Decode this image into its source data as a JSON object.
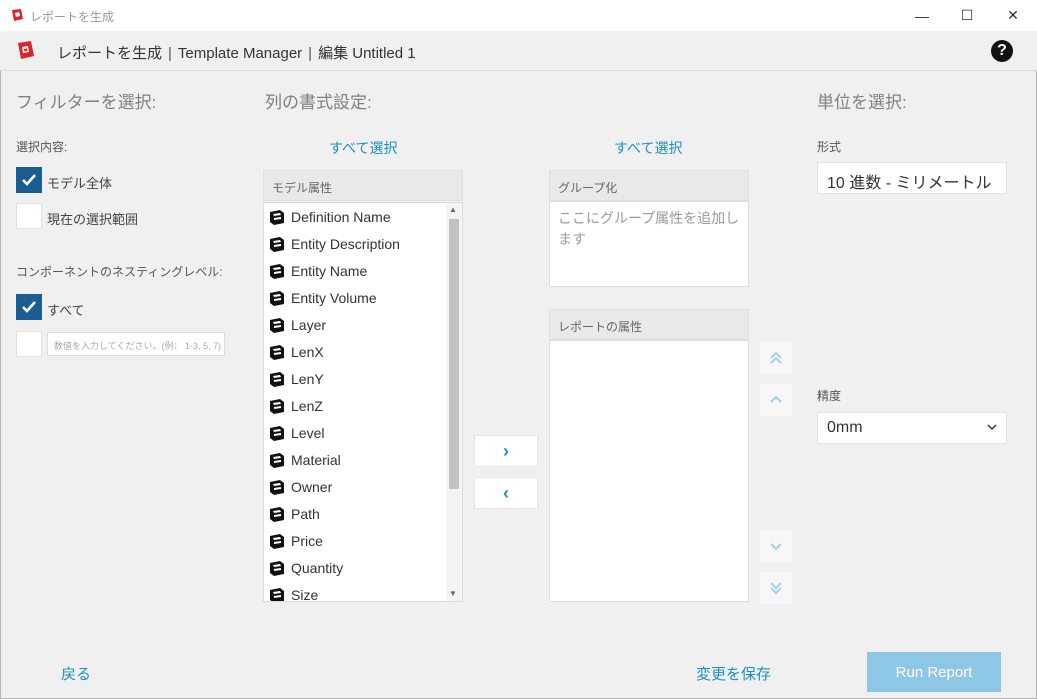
{
  "window": {
    "title": "レポートを生成",
    "minimize": "—",
    "maximize": "☐",
    "close": "✕"
  },
  "header": {
    "crumb1": "レポートを生成",
    "crumb2": "Template Manager",
    "crumb3": "編集 Untitled 1",
    "separator": "|",
    "help": "?"
  },
  "filters": {
    "title": "フィルターを選択:",
    "selection_label": "選択内容:",
    "whole_model": "モデル全体",
    "current_selection": "現在の選択範囲",
    "nesting_label": "コンポーネントのネスティングレベル:",
    "all": "すべて",
    "nest_placeholder": "数値を入力してください。(例： 1-3, 5, 7)"
  },
  "columns": {
    "title": "列の書式設定:",
    "select_all_left": "すべて選択",
    "select_all_right": "すべて選択",
    "model_attrs_header": "モデル属性",
    "group_header": "グループ化",
    "group_placeholder": "ここにグループ属性を追加します",
    "report_attrs_header": "レポートの属性",
    "attributes": [
      "Definition Name",
      "Entity Description",
      "Entity Name",
      "Entity Volume",
      "Layer",
      "LenX",
      "LenY",
      "LenZ",
      "Level",
      "Material",
      "Owner",
      "Path",
      "Price",
      "Quantity",
      "Size"
    ],
    "move_right": "›",
    "move_left": "‹"
  },
  "units": {
    "title": "単位を選択:",
    "format_label": "形式",
    "format_value": "10 進数 - ミリメートル",
    "precision_label": "精度",
    "precision_value": "0mm"
  },
  "footer": {
    "back": "戻る",
    "save": "変更を保存",
    "run": "Run Report"
  },
  "colors": {
    "accent": "#1e8fc2",
    "checkbox": "#1a5d93",
    "run_button": "#8ec7e6"
  }
}
